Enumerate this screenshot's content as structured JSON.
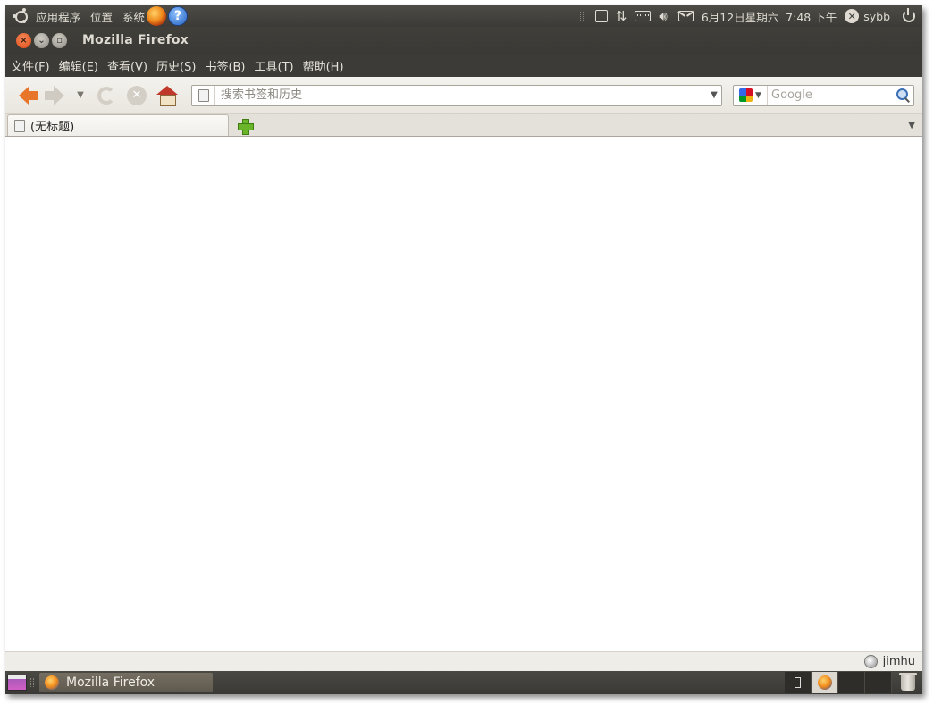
{
  "top_panel": {
    "menus": [
      "应用程序",
      "位置",
      "系统"
    ],
    "launchers": {
      "firefox": "firefox-icon",
      "help": "help-icon",
      "help_glyph": "?"
    },
    "indicators": [
      "notes-icon",
      "network-icon",
      "keyboard-icon",
      "volume-icon",
      "mail-icon"
    ],
    "clock": "6月12日星期六  7:48 下午",
    "user": "sybb",
    "status_glyph": "✕"
  },
  "window": {
    "title": "Mozilla Firefox",
    "buttons": {
      "close": "×",
      "minimize": "⌄",
      "maximize": "▫"
    }
  },
  "menubar": [
    {
      "label": "文件(F)",
      "key": "file"
    },
    {
      "label": "编辑(E)",
      "key": "edit"
    },
    {
      "label": "查看(V)",
      "key": "view"
    },
    {
      "label": "历史(S)",
      "key": "history"
    },
    {
      "label": "书签(B)",
      "key": "bookmarks"
    },
    {
      "label": "工具(T)",
      "key": "tools"
    },
    {
      "label": "帮助(H)",
      "key": "help"
    }
  ],
  "navbar": {
    "url_value": "",
    "url_placeholder": "搜索书签和历史",
    "dropdown_glyph": "▼",
    "search_engine": "Google",
    "search_placeholder": "Google",
    "stop_glyph": "✕"
  },
  "tabs": [
    {
      "label": "(无标题)",
      "selected": true
    }
  ],
  "statusbar": {
    "user": "jimhu"
  },
  "bottom_panel": {
    "task_label": "Mozilla Firefox",
    "workspaces": 4,
    "active_workspace": 1
  },
  "colors": {
    "panel_bg": "#3c3b37",
    "panel_text": "#dfdbd2",
    "accent_orange": "#dd4814",
    "toolbar_bg": "#efede8"
  }
}
